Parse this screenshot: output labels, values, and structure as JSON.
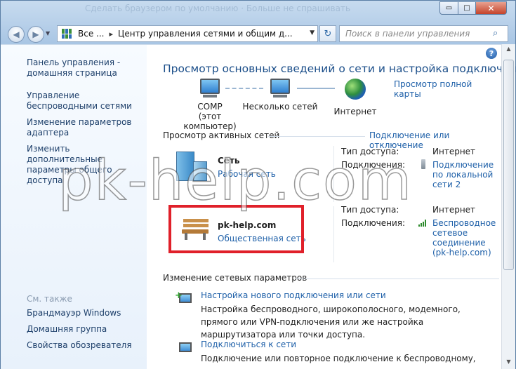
{
  "window": {
    "title_ghost": "Сделать браузером по умолчанию · Больше не спрашивать",
    "controls": {
      "min": "▭",
      "max": "□",
      "close": "✕"
    }
  },
  "nav": {
    "back": "◀",
    "forward": "▶",
    "history_drop": "▼",
    "crumb_root": "Все ...",
    "crumb_sep": "▸",
    "crumb_current": "Центр управления сетями и общим д...",
    "address_drop": "▼",
    "refresh": "↻",
    "search_placeholder": "Поиск в панели управления",
    "search_icon": "⌕"
  },
  "sidebar": {
    "home": "Панель управления - домашняя страница",
    "tasks": [
      "Управление беспроводными сетями",
      "Изменение параметров адаптера",
      "Изменить дополнительные параметры общего доступа"
    ],
    "see_also_header": "См. также",
    "see_also": [
      "Брандмауэр Windows",
      "Домашняя группа",
      "Свойства обозревателя"
    ]
  },
  "main": {
    "help": "?",
    "heading": "Просмотр основных сведений о сети и настройка подключений",
    "full_map_link": "Просмотр полной карты",
    "nodes": {
      "computer_name": "COMP",
      "computer_sub": "(этот компьютер)",
      "multi": "Несколько сетей",
      "internet": "Интернет"
    },
    "active_header": "Просмотр активных сетей",
    "connect_link": "Подключение или отключение",
    "networks": [
      {
        "name": "Сеть",
        "type": "Рабочая сеть",
        "access_label": "Тип доступа:",
        "access_value": "Интернет",
        "conn_label": "Подключения:",
        "conn_value": "Подключение по локальной сети 2"
      },
      {
        "name": "pk-help.com",
        "type": "Общественная сеть",
        "access_label": "Тип доступа:",
        "access_value": "Интернет",
        "conn_label": "Подключения:",
        "conn_value": "Беспроводное сетевое соединение (pk-help.com)"
      }
    ],
    "change_header": "Изменение сетевых параметров",
    "tasks": [
      {
        "title": "Настройка нового подключения или сети",
        "desc": "Настройка беспроводного, широкополосного, модемного, прямого или VPN-подключения или же настройка маршрутизатора или точки доступа."
      },
      {
        "title": "Подключиться к сети",
        "desc": "Подключение или повторное подключение к беспроводному,"
      }
    ]
  },
  "watermark": "pk-help.com",
  "colors": {
    "link": "#1d5fa8",
    "heading": "#1c4f8a",
    "highlight": "#e0202a"
  }
}
